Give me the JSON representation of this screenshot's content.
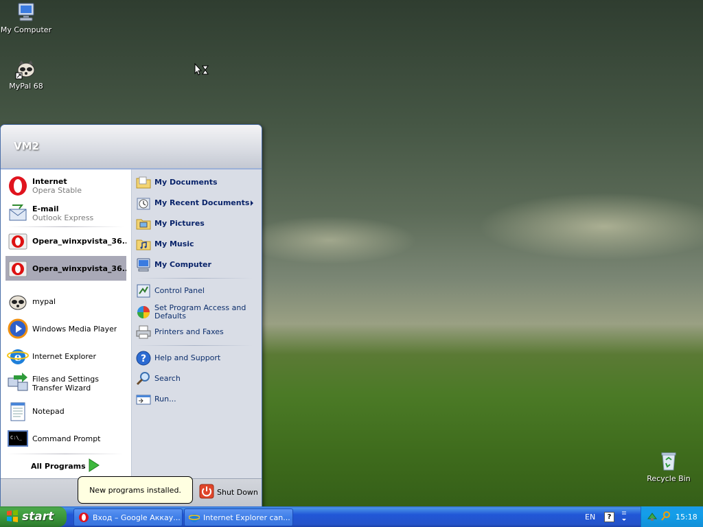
{
  "desktop": {
    "icons": [
      {
        "label": "My Computer"
      },
      {
        "label": "MyPal 68"
      },
      {
        "label": "Recycle Bin"
      }
    ]
  },
  "start_menu": {
    "user": "VM2",
    "pinned": [
      {
        "title": "Internet",
        "subtitle": "Opera Stable",
        "icon": "opera-icon"
      },
      {
        "title": "E-mail",
        "subtitle": "Outlook Express",
        "icon": "outlook-express-icon"
      }
    ],
    "recent": [
      {
        "title": "Opera_winxpvista_36....",
        "icon": "opera-installer-icon"
      },
      {
        "title": "Opera_winxpvista_36....",
        "icon": "opera-installer-icon",
        "selected": true
      },
      {
        "title": "mypal",
        "icon": "mypal-icon"
      },
      {
        "title": "Windows Media Player",
        "icon": "media-player-icon"
      },
      {
        "title": "Internet Explorer",
        "icon": "internet-explorer-icon"
      },
      {
        "title": "Files and Settings Transfer Wizard",
        "icon": "transfer-wizard-icon"
      },
      {
        "title": "Notepad",
        "icon": "notepad-icon"
      },
      {
        "title": "Command Prompt",
        "icon": "command-prompt-icon"
      }
    ],
    "all_programs": "All Programs",
    "right": [
      {
        "label": "My Documents"
      },
      {
        "label": "My Recent Documents"
      },
      {
        "label": "My Pictures"
      },
      {
        "label": "My Music"
      },
      {
        "label": "My Computer"
      },
      {
        "label": "Control Panel"
      },
      {
        "label": "Set Program Access and Defaults"
      },
      {
        "label": "Printers and Faxes"
      },
      {
        "label": "Help and Support"
      },
      {
        "label": "Search"
      },
      {
        "label": "Run..."
      }
    ],
    "shutdown": "Shut Down",
    "balloon": "New programs installed."
  },
  "taskbar": {
    "start": "start",
    "tasks": [
      {
        "label": "Вход – Google Аккау..."
      },
      {
        "label": "Internet Explorer can..."
      }
    ],
    "language": "EN",
    "help": "?",
    "clock": "15:18"
  }
}
